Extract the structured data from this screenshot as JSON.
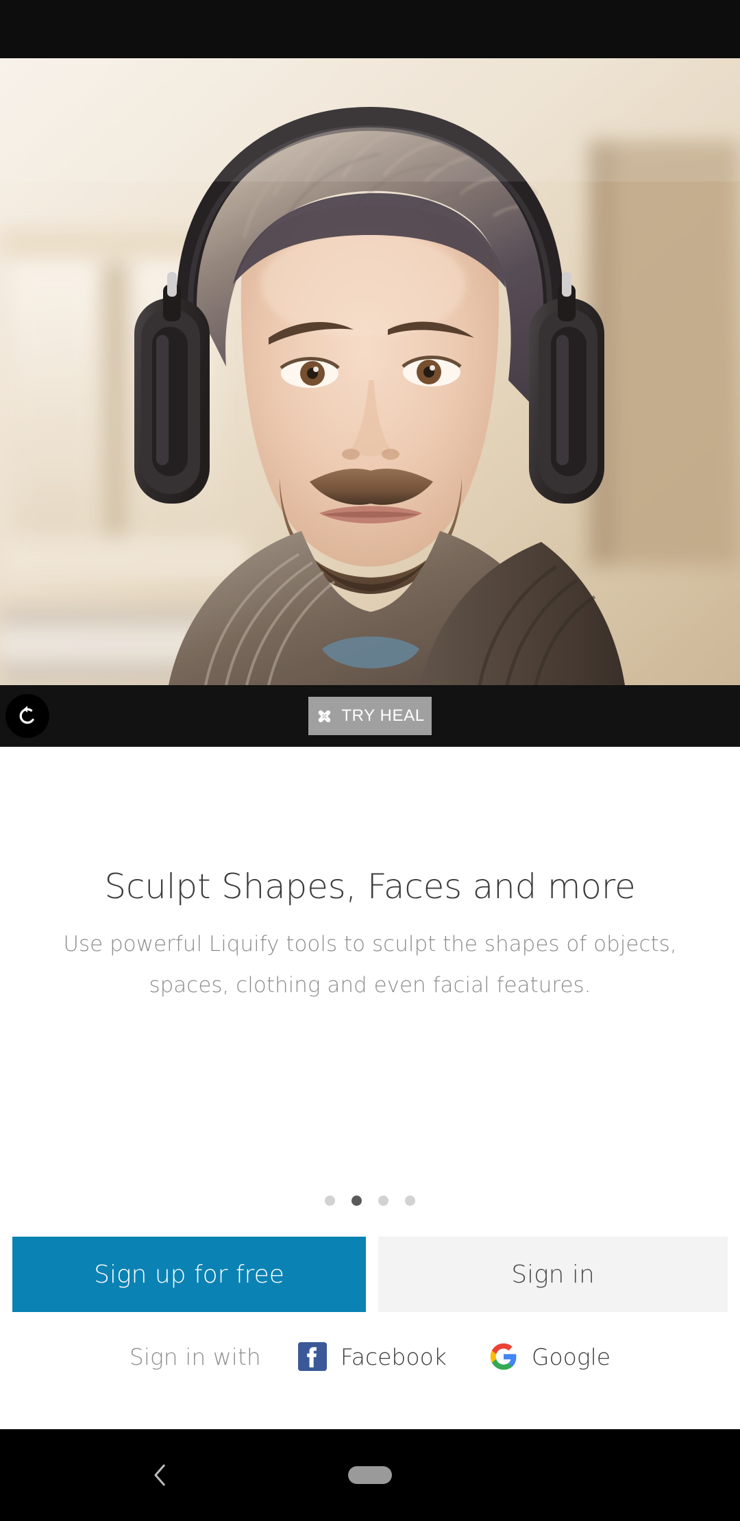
{
  "app": {
    "screen_name": "onboarding-carousel",
    "status_bar_color": "#0d0d0d"
  },
  "editor": {
    "reset_icon": "reset-circular-arrow-icon",
    "heal_button": {
      "label": "TRY HEAL",
      "icon": "bandage-heal-icon",
      "background": "#a0a0a0",
      "text_color": "#ffffff"
    },
    "toolbar_background": "#121212"
  },
  "photo": {
    "alt": "Close-up portrait of a bearded man wearing over-ear headphones and a scarf",
    "subject": "man-with-headphones-portrait"
  },
  "onboarding": {
    "headline": "Sculpt Shapes, Faces and more",
    "body": "Use powerful Liquify tools to sculpt the shapes of objects, spaces, clothing and even facial features.",
    "pager": {
      "total": 4,
      "active_index": 1,
      "inactive_color": "#d2d2d2",
      "active_color": "#5a5a5a"
    }
  },
  "auth": {
    "sign_up_label": "Sign up for free",
    "sign_up_color": "#0b82b4",
    "sign_in_label": "Sign in",
    "sign_in_color": "#f3f3f3",
    "social_prompt": "Sign in with",
    "providers": [
      {
        "name": "Facebook",
        "icon": "facebook-icon",
        "color": "#3b5998"
      },
      {
        "name": "Google",
        "icon": "google-g-icon",
        "color": "#4285f4"
      }
    ]
  },
  "navbar": {
    "back_icon": "back-chevron-icon",
    "home_icon": "home-pill-icon",
    "background": "#000000"
  }
}
